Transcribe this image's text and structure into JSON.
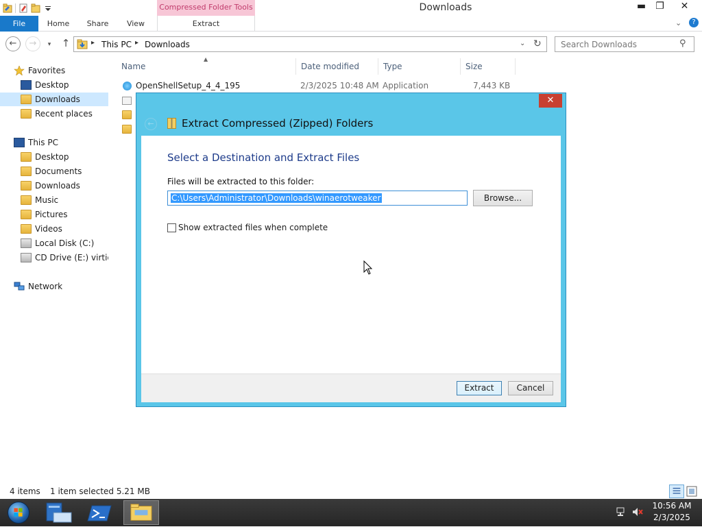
{
  "window": {
    "title": "Downloads",
    "context_tab_group": "Compressed Folder Tools",
    "min_symbol": "▬",
    "max_symbol": "❐",
    "close_symbol": "✕"
  },
  "ribbon": {
    "tabs": [
      "File",
      "Home",
      "Share",
      "View",
      "Extract"
    ],
    "expand_symbol": "⌄",
    "help_symbol": "?"
  },
  "nav": {
    "back_symbol": "←",
    "forward_symbol": "→",
    "recent_symbol": "▾",
    "up_symbol": "↑",
    "breadcrumbs": [
      "This PC",
      "Downloads"
    ],
    "crumb_separator": "▸",
    "dropdown_symbol": "⌄",
    "refresh_symbol": "↻",
    "search_placeholder": "Search Downloads",
    "search_symbol": "⚲"
  },
  "navpane": {
    "favorites": {
      "label": "Favorites",
      "items": [
        "Desktop",
        "Downloads",
        "Recent places"
      ]
    },
    "this_pc": {
      "label": "This PC",
      "items": [
        "Desktop",
        "Documents",
        "Downloads",
        "Music",
        "Pictures",
        "Videos",
        "Local Disk (C:)",
        "CD Drive (E:) virtio-v"
      ]
    },
    "network": {
      "label": "Network"
    },
    "selected_item": "Downloads"
  },
  "filelist": {
    "columns": [
      "Name",
      "Date modified",
      "Type",
      "Size"
    ],
    "sort_symbol": "▲",
    "rows": [
      {
        "name": "OpenShellSetup_4_4_195",
        "date": "2/3/2025 10:48 AM",
        "type": "Application",
        "size": "7,443 KB"
      }
    ]
  },
  "dialog": {
    "title": "Extract Compressed (Zipped) Folders",
    "close_symbol": "✕",
    "back_symbol": "←",
    "heading": "Select a Destination and Extract Files",
    "dest_label": "Files will be extracted to this folder:",
    "dest_value": "C:\\Users\\Administrator\\Downloads\\winaerotweaker",
    "browse_label": "Browse...",
    "show_files_label": "Show extracted files when complete",
    "show_files_checked": false,
    "extract_label": "Extract",
    "cancel_label": "Cancel"
  },
  "statusbar": {
    "item_count": "4 items",
    "selection": "1 item selected  5.21 MB"
  },
  "taskbar": {
    "time": "10:56 AM",
    "date": "2/3/2025"
  },
  "colors": {
    "accent": "#1979ca",
    "dialog_frame": "#5ac6e8",
    "context_tab": "#f7c6d6",
    "close_red": "#c84031",
    "selection_blue": "#3399ff",
    "nav_selected": "#cde8ff"
  },
  "icons": {
    "qat": [
      "folder-properties-icon",
      "new-folder-icon",
      "qat-dropdown-icon"
    ],
    "navpane": [
      "star-icon",
      "monitor-icon",
      "folder-icon",
      "recent-places-icon",
      "computer-icon",
      "drive-icon",
      "cd-drive-icon",
      "network-icon"
    ],
    "taskbar": [
      "windows-orb-icon",
      "server-manager-icon",
      "powershell-icon",
      "file-explorer-icon",
      "network-tray-icon",
      "volume-muted-icon"
    ]
  }
}
